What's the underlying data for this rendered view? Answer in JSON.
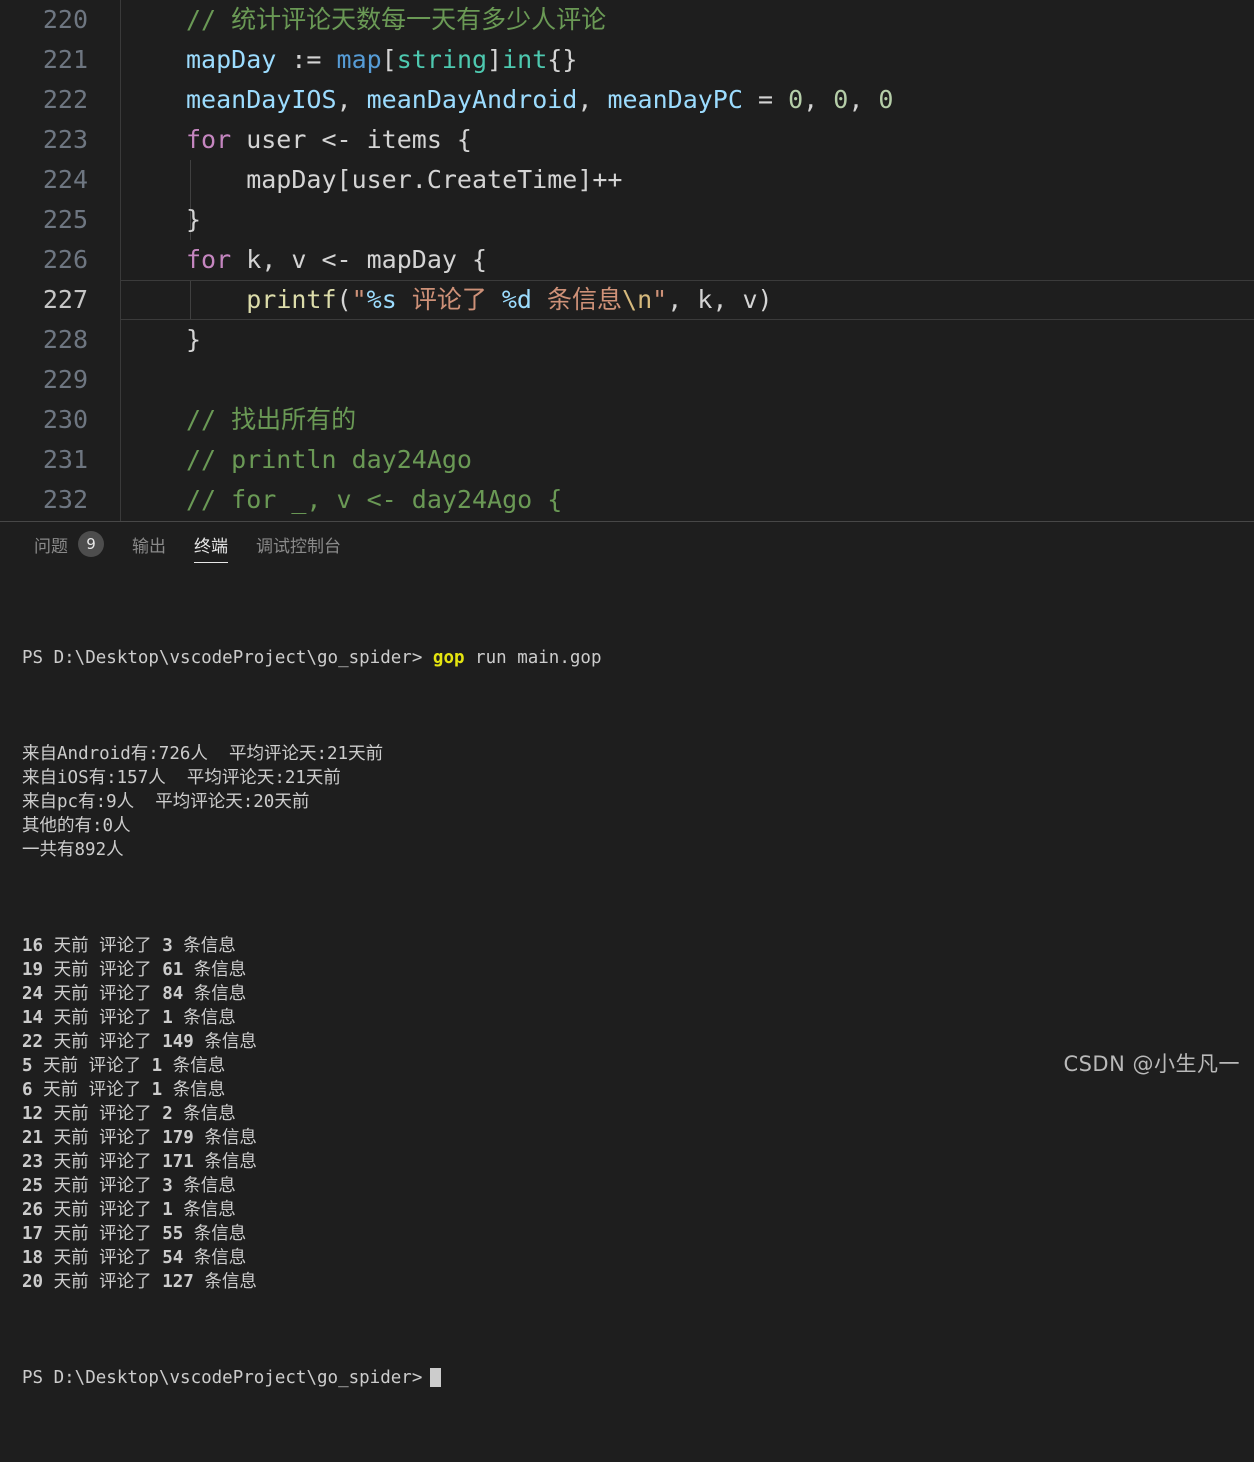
{
  "editor": {
    "lines": [
      {
        "number": "220",
        "tokens": [
          {
            "text": "// 统计评论天数每一天有多少人评论",
            "cls": "t-comment"
          }
        ]
      },
      {
        "number": "221",
        "tokens": [
          {
            "text": "mapDay ",
            "cls": "t-var"
          },
          {
            "text": ":= ",
            "cls": "t-plain"
          },
          {
            "text": "map",
            "cls": "t-type"
          },
          {
            "text": "[",
            "cls": "t-punct"
          },
          {
            "text": "string",
            "cls": "t-type2"
          },
          {
            "text": "]",
            "cls": "t-punct"
          },
          {
            "text": "int",
            "cls": "t-type2"
          },
          {
            "text": "{}",
            "cls": "t-punct"
          }
        ]
      },
      {
        "number": "222",
        "tokens": [
          {
            "text": "meanDayIOS",
            "cls": "t-var"
          },
          {
            "text": ", ",
            "cls": "t-plain"
          },
          {
            "text": "meanDayAndroid",
            "cls": "t-var"
          },
          {
            "text": ", ",
            "cls": "t-plain"
          },
          {
            "text": "meanDayPC",
            "cls": "t-var"
          },
          {
            "text": " = ",
            "cls": "t-plain"
          },
          {
            "text": "0",
            "cls": "t-num"
          },
          {
            "text": ", ",
            "cls": "t-plain"
          },
          {
            "text": "0",
            "cls": "t-num"
          },
          {
            "text": ", ",
            "cls": "t-plain"
          },
          {
            "text": "0",
            "cls": "t-num"
          }
        ]
      },
      {
        "number": "223",
        "tokens": [
          {
            "text": "for",
            "cls": "t-kw"
          },
          {
            "text": " user <- items {",
            "cls": "t-plain"
          }
        ]
      },
      {
        "number": "224",
        "tokens": [
          {
            "text": "    mapDay[user.CreateTime]++",
            "cls": "t-plain"
          }
        ]
      },
      {
        "number": "225",
        "tokens": [
          {
            "text": "}",
            "cls": "t-plain"
          }
        ]
      },
      {
        "number": "226",
        "tokens": [
          {
            "text": "for",
            "cls": "t-kw"
          },
          {
            "text": " k, v <- mapDay {",
            "cls": "t-plain"
          }
        ]
      },
      {
        "number": "227",
        "active": true,
        "tokens": [
          {
            "text": "    ",
            "cls": "t-plain"
          },
          {
            "text": "printf",
            "cls": "t-fn"
          },
          {
            "text": "(",
            "cls": "t-punct"
          },
          {
            "text": "\"",
            "cls": "t-str"
          },
          {
            "text": "%s",
            "cls": "t-var"
          },
          {
            "text": " 评论了 ",
            "cls": "t-str"
          },
          {
            "text": "%d",
            "cls": "t-var"
          },
          {
            "text": " 条信息",
            "cls": "t-str"
          },
          {
            "text": "\\n",
            "cls": "t-esc"
          },
          {
            "text": "\"",
            "cls": "t-str"
          },
          {
            "text": ", k, v)",
            "cls": "t-plain"
          }
        ]
      },
      {
        "number": "228",
        "tokens": [
          {
            "text": "}",
            "cls": "t-plain"
          }
        ]
      },
      {
        "number": "229",
        "tokens": []
      },
      {
        "number": "230",
        "tokens": [
          {
            "text": "// 找出所有的",
            "cls": "t-comment"
          }
        ]
      },
      {
        "number": "231",
        "tokens": [
          {
            "text": "// println day24Ago",
            "cls": "t-comment"
          }
        ]
      },
      {
        "number": "232",
        "tokens": [
          {
            "text": "// for _, v <- day24Ago {",
            "cls": "t-comment"
          }
        ]
      }
    ]
  },
  "panel": {
    "tabs": [
      {
        "label": "问题",
        "badge": "9",
        "active": false
      },
      {
        "label": "输出",
        "badge": null,
        "active": false
      },
      {
        "label": "终端",
        "badge": null,
        "active": true
      },
      {
        "label": "调试控制台",
        "badge": null,
        "active": false
      }
    ],
    "terminal": {
      "prompt": "PS D:\\Desktop\\vscodeProject\\go_spider> ",
      "command_highlight": "gop",
      "command_rest": " run main.gop",
      "summary_lines": [
        "来自Android有:726人  平均评论天:21天前",
        "来自iOS有:157人  平均评论天:21天前",
        "来自pc有:9人  平均评论天:20天前",
        "其他的有:0人",
        "一共有892人"
      ],
      "day_rows": [
        {
          "day": "16",
          "count": "3"
        },
        {
          "day": "19",
          "count": "61"
        },
        {
          "day": "24",
          "count": "84"
        },
        {
          "day": "14",
          "count": "1"
        },
        {
          "day": "22",
          "count": "149"
        },
        {
          "day": "5",
          "count": "1"
        },
        {
          "day": "6",
          "count": "1"
        },
        {
          "day": "12",
          "count": "2"
        },
        {
          "day": "21",
          "count": "179"
        },
        {
          "day": "23",
          "count": "171"
        },
        {
          "day": "25",
          "count": "3"
        },
        {
          "day": "26",
          "count": "1"
        },
        {
          "day": "17",
          "count": "55"
        },
        {
          "day": "18",
          "count": "54"
        },
        {
          "day": "20",
          "count": "127"
        }
      ],
      "row_mid": " 天前 评论了 ",
      "row_suffix": " 条信息",
      "final_prompt": "PS D:\\Desktop\\vscodeProject\\go_spider>"
    }
  },
  "watermark": {
    "text": "CSDN @小生凡一"
  },
  "colors": {
    "editor_bg": "#1e1e1e",
    "comment": "#6a9955",
    "variable": "#9cdcfe",
    "keyword": "#c586c0",
    "type": "#569cd6",
    "string": "#ce9178",
    "function": "#dcdcaa",
    "number": "#b5cea8",
    "terminal_text": "#cccccc",
    "terminal_highlight": "#e5e510"
  }
}
